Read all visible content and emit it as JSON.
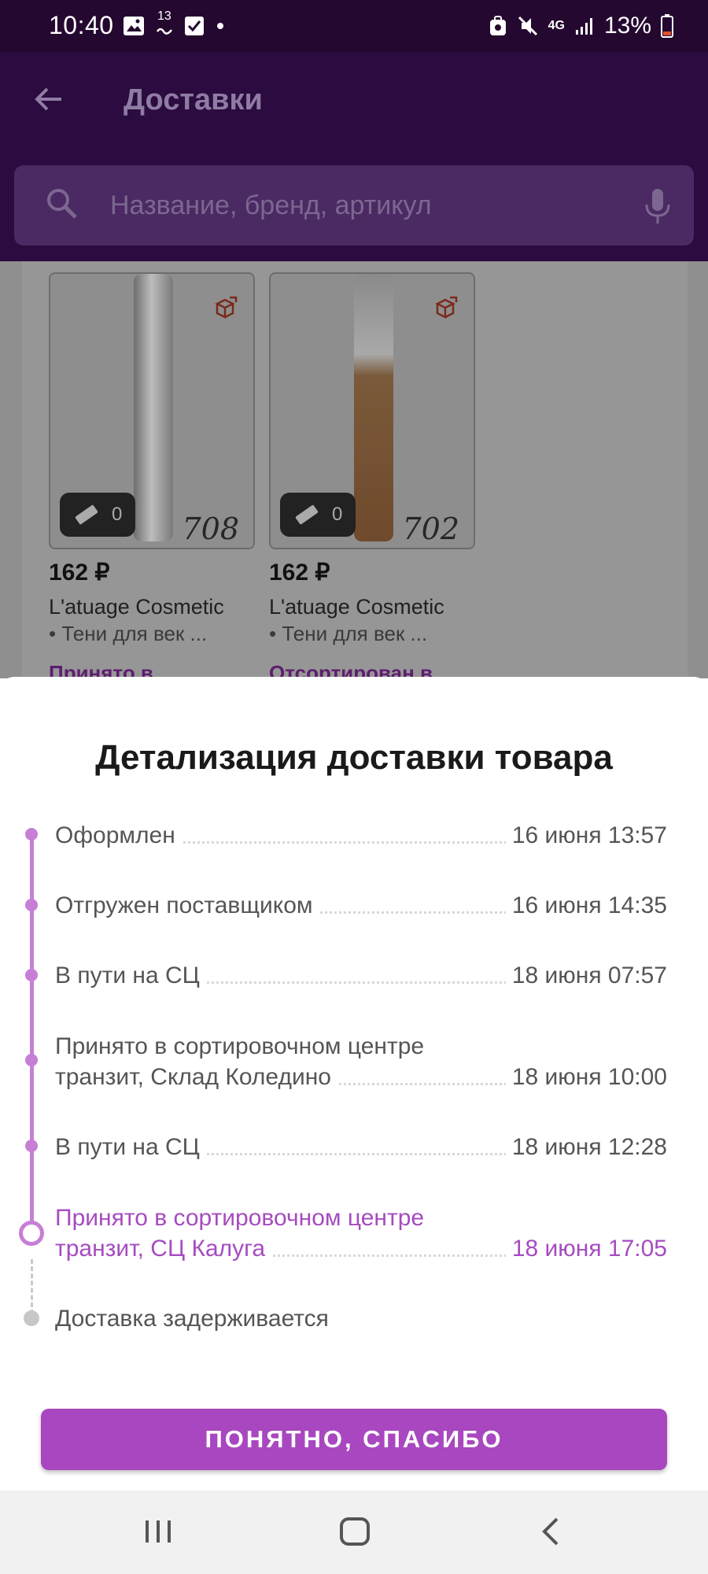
{
  "status_bar": {
    "time": "10:40",
    "notification_count": "13",
    "network": "4G",
    "battery": "13%"
  },
  "app_bar": {
    "title": "Доставки",
    "search_placeholder": "Название, бренд, артикул"
  },
  "products": [
    {
      "price": "162 ₽",
      "brand": "L'atuage Cosmetic",
      "subtitle": "• Тени для век ...",
      "ruler_count": "0",
      "handwritten": "708",
      "status_peek": "Принято в"
    },
    {
      "price": "162 ₽",
      "brand": "L'atuage Cosmetic",
      "subtitle": "• Тени для век ...",
      "ruler_count": "0",
      "handwritten": "702",
      "status_peek": "Отсортирован в"
    }
  ],
  "sheet": {
    "title": "Детализация доставки товара",
    "events": [
      {
        "label": "Оформлен",
        "when": "16 июня 13:57"
      },
      {
        "label": "Отгружен поставщиком",
        "when": "16 июня 14:35"
      },
      {
        "label": "В пути на СЦ",
        "when": "18 июня 07:57"
      },
      {
        "label_line1": "Принято в сортировочном центре",
        "label_line2": "транзит, Склад Коледино",
        "when": "18 июня 10:00"
      },
      {
        "label": "В пути на СЦ",
        "when": "18 июня 12:28"
      },
      {
        "label_line1": "Принято в сортировочном центре",
        "label_line2": "транзит, СЦ Калуга",
        "when": "18 июня 17:05"
      },
      {
        "label": "Доставка задерживается"
      }
    ],
    "confirm_button": "ПОНЯТНО, СПАСИБО"
  },
  "colors": {
    "accent": "#a847bf",
    "timeline": "#c77fd6",
    "status_bar": "#25082f"
  }
}
